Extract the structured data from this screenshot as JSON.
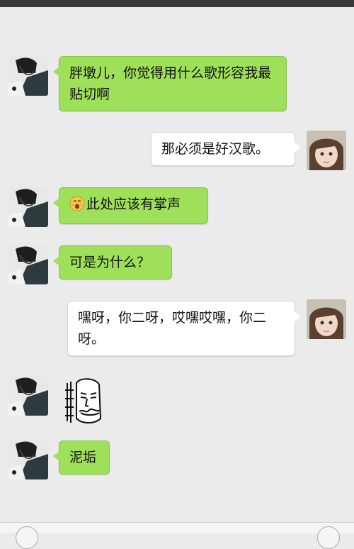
{
  "chat": {
    "messages": [
      {
        "side": "left",
        "text": "胖墩儿，你觉得用什么歌形容我最贴切啊"
      },
      {
        "side": "right",
        "text": "那必须是好汉歌。"
      },
      {
        "side": "left",
        "text": "此处应该有掌声",
        "emoji": "clapping-face-emoji"
      },
      {
        "side": "left",
        "text": "可是为什么？"
      },
      {
        "side": "right",
        "text": "嘿呀，你二呀，哎嘿哎嘿，你二呀。"
      },
      {
        "side": "left",
        "sticker": "rage-face-sticker"
      },
      {
        "side": "left",
        "text": "泥垢"
      }
    ]
  },
  "colors": {
    "background": "#ebebeb",
    "sent_bubble": "#9fe05a",
    "received_bubble": "#ffffff"
  }
}
